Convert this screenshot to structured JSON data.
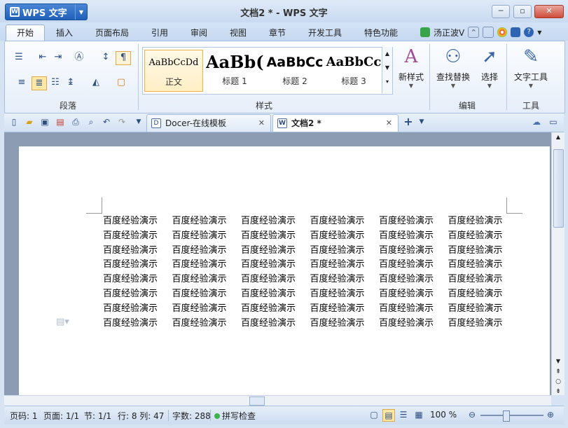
{
  "app": {
    "name": "WPS 文字",
    "logo_letter": "W"
  },
  "window": {
    "title": "文档2 * - WPS 文字",
    "min": "─",
    "restore": "▫",
    "close": "✕"
  },
  "menu": {
    "tabs": [
      "开始",
      "插入",
      "页面布局",
      "引用",
      "审阅",
      "视图",
      "章节",
      "开发工具",
      "特色功能"
    ],
    "active": "开始",
    "user": "汤正波V",
    "help": "?"
  },
  "ribbon": {
    "groups": {
      "paragraph": "段落",
      "style": "样式",
      "edit": "编辑",
      "tools": "工具"
    },
    "styles": [
      {
        "sample": "AaBbCcDd",
        "name": "正文",
        "selected": true
      },
      {
        "sample": "AaBb(",
        "name": "标题 1"
      },
      {
        "sample": "AaBbCc",
        "name": "标题 2"
      },
      {
        "sample": "AaBbCc",
        "name": "标题 3"
      }
    ],
    "new_style": "新样式",
    "find_replace": "查找替换",
    "select": "选择",
    "text_tools": "文字工具"
  },
  "doc_tabs": [
    {
      "label": "Docer-在线模板",
      "active": false
    },
    {
      "label": "文档2 *",
      "active": true
    }
  ],
  "document": {
    "cell_text": "百度经验演示",
    "rows": 8,
    "cols": 6
  },
  "status": {
    "page": "页码: 1",
    "pages": "页面: 1/1",
    "section": "节: 1/1",
    "row_col": "行: 8  列: 47",
    "word_count": "字数: 288",
    "spell_check": "拼写检查",
    "zoom": "100 %"
  },
  "colors": {
    "accent": "#1f5fb8",
    "spell_ok": "#3bb34a"
  }
}
